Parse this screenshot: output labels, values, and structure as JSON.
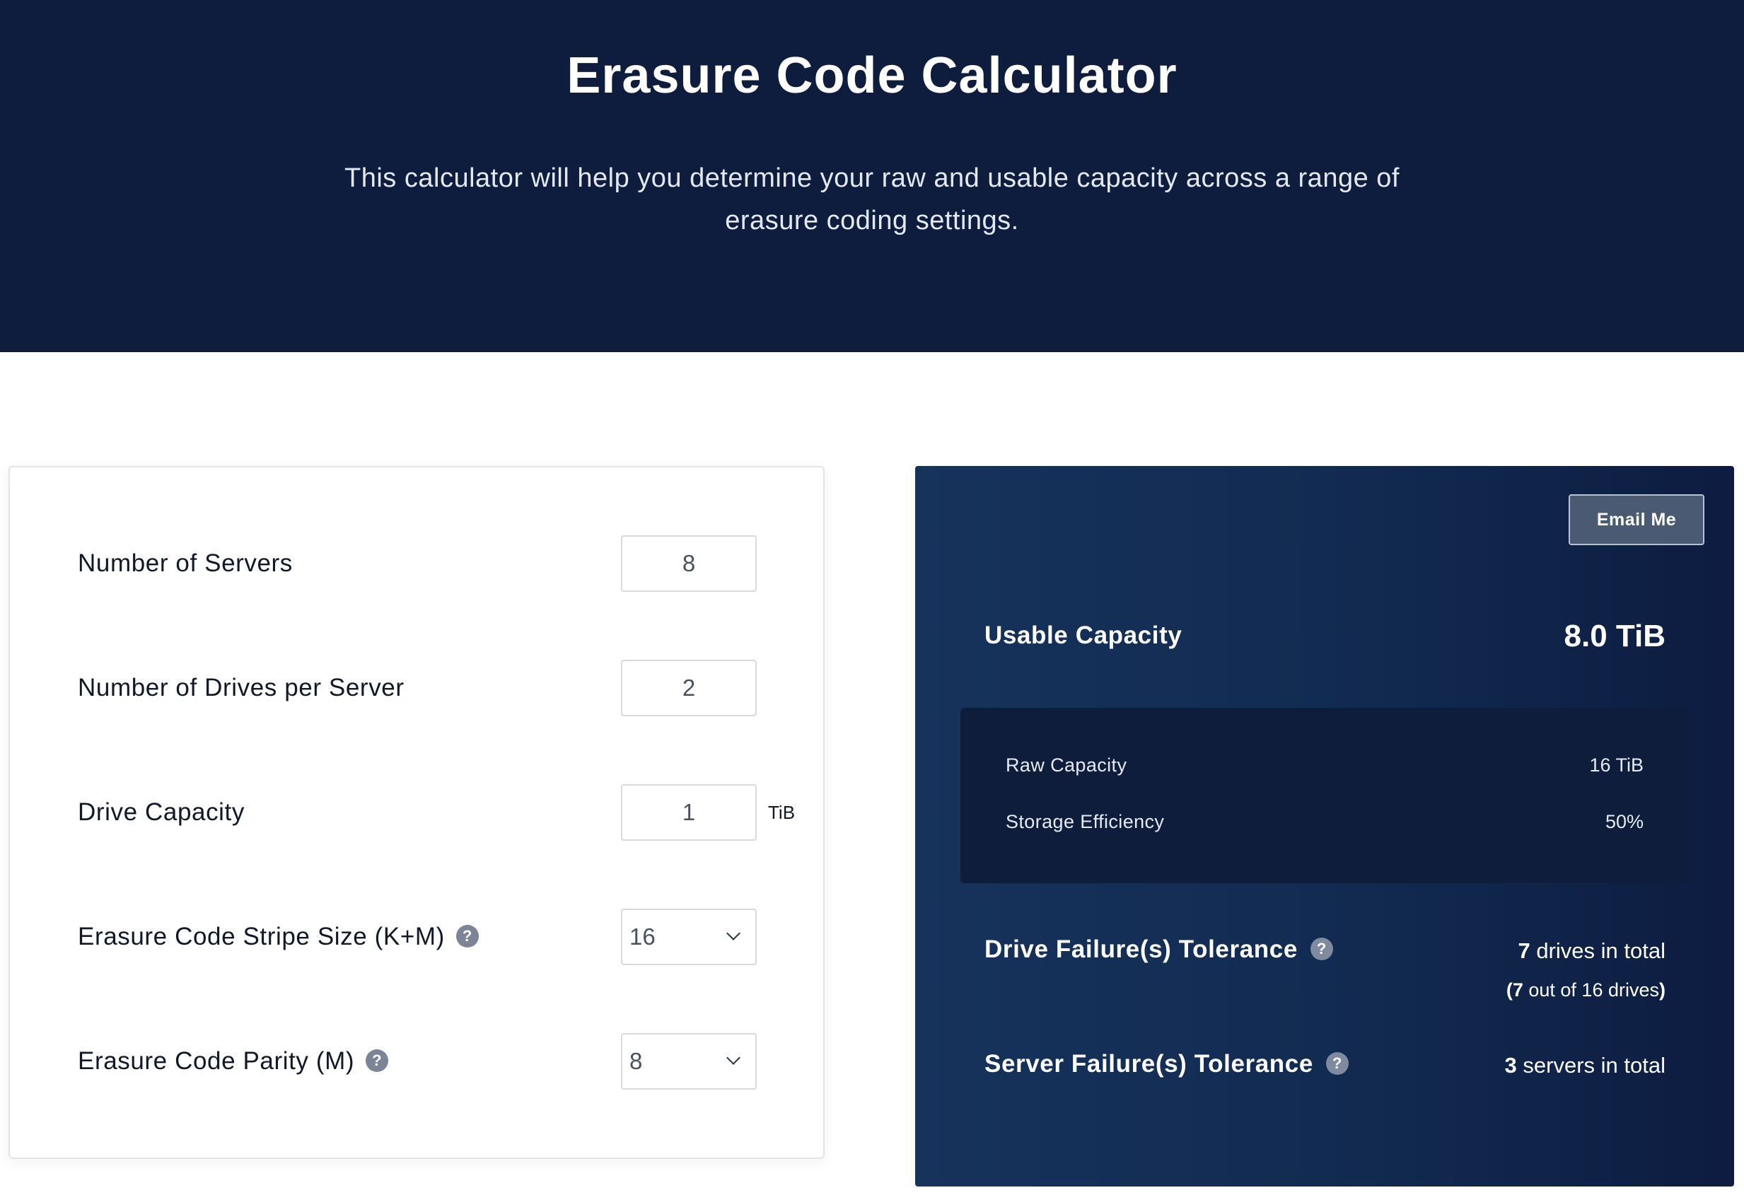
{
  "header": {
    "title": "Erasure Code Calculator",
    "subtitle": "This calculator will help you determine your raw and usable capacity across a range of erasure coding settings."
  },
  "inputs": {
    "servers": {
      "label": "Number of Servers",
      "value": "8"
    },
    "drives": {
      "label": "Number of Drives per Server",
      "value": "2"
    },
    "capacity": {
      "label": "Drive Capacity",
      "value": "1",
      "unit": "TiB"
    },
    "stripe": {
      "label": "Erasure Code Stripe Size (K+M)",
      "value": "16"
    },
    "parity": {
      "label": "Erasure Code Parity (M)",
      "value": "8"
    },
    "help_glyph": "?"
  },
  "results": {
    "email_label": "Email Me",
    "usable_label": "Usable Capacity",
    "usable_value": "8.0 TiB",
    "raw_label": "Raw Capacity",
    "raw_value": "16 TiB",
    "efficiency_label": "Storage Efficiency",
    "efficiency_value": "50%",
    "drive_tol_label": "Drive Failure(s) Tolerance",
    "drive_tol_count": "7",
    "drive_tol_text": " drives in total",
    "drive_tol_sub_open": "(",
    "drive_tol_sub_count": "7",
    "drive_tol_sub_text": " out of 16 drives",
    "drive_tol_sub_close": ")",
    "server_tol_label": "Server Failure(s) Tolerance",
    "server_tol_count": "3",
    "server_tol_text": " servers in total"
  },
  "colors": {
    "hero_bg": "#0e1c3d",
    "panel_gradient_start": "#16335c",
    "panel_gradient_end": "#0d1c40",
    "help_icon": "#7b8597"
  }
}
